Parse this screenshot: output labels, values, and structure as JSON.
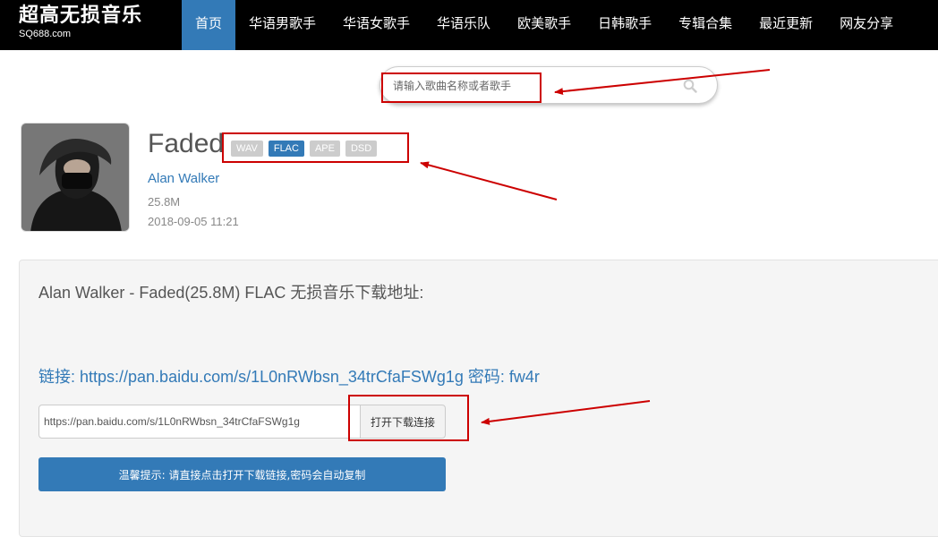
{
  "site": {
    "title": "超高无损音乐",
    "domain": "SQ688.com"
  },
  "nav": [
    {
      "label": "首页",
      "active": true
    },
    {
      "label": "华语男歌手"
    },
    {
      "label": "华语女歌手"
    },
    {
      "label": "华语乐队"
    },
    {
      "label": "欧美歌手"
    },
    {
      "label": "日韩歌手"
    },
    {
      "label": "专辑合集"
    },
    {
      "label": "最近更新"
    },
    {
      "label": "网友分享"
    }
  ],
  "search": {
    "placeholder": "请输入歌曲名称或者歌手",
    "icon": "search-icon"
  },
  "song": {
    "title": "Faded",
    "formats": [
      {
        "label": "WAV",
        "active": false
      },
      {
        "label": "FLAC",
        "active": true
      },
      {
        "label": "APE",
        "active": false
      },
      {
        "label": "DSD",
        "active": false
      }
    ],
    "artist": "Alan Walker",
    "size": "25.8M",
    "date": "2018-09-05 11:21"
  },
  "download": {
    "heading": "Alan Walker - Faded(25.8M) FLAC 无损音乐下载地址:",
    "link_line": "链接: https://pan.baidu.com/s/1L0nRWbsn_34trCfaFSWg1g 密码: fw4r",
    "link_value": "https://pan.baidu.com/s/1L0nRWbsn_34trCfaFSWg1g",
    "open_button": "打开下载连接",
    "tip_button": "温馨提示: 请直接点击打开下载链接,密码会自动复制"
  },
  "colors": {
    "accent": "#337ab7",
    "annotation": "#c00000",
    "topbar": "#000000"
  }
}
